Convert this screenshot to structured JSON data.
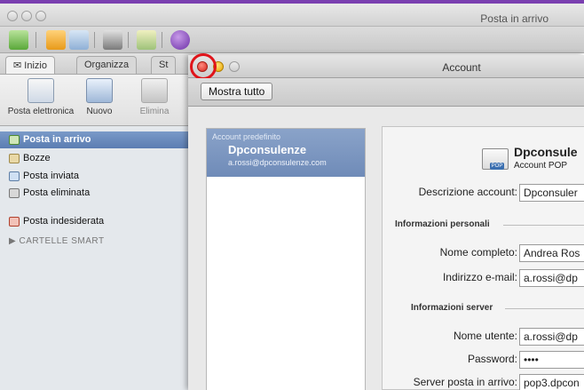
{
  "back_window": {
    "title": "Posta in arrivo",
    "ribbon_tabs": [
      "Inizio",
      "Organizza",
      "St"
    ],
    "ribbon_buttons": [
      "Posta elettronica",
      "Nuovo",
      "Elimina"
    ],
    "folders": [
      "Posta in arrivo",
      "Bozze",
      "Posta inviata",
      "Posta eliminata",
      "Posta indesiderata"
    ],
    "smart_folders": "CARTELLE SMART"
  },
  "front_window": {
    "title": "Account",
    "show_all": "Mostra tutto",
    "account_list": {
      "category": "Account predefinito",
      "name": "Dpconsulenze",
      "email": "a.rossi@dpconsulenze.com"
    },
    "detail": {
      "title": "Dpconsule",
      "subtitle": "Account POP",
      "pop_badge": "POP",
      "description_label": "Descrizione account:",
      "description_value": "Dpconsuler",
      "section_personal": "Informazioni personali",
      "fullname_label": "Nome completo:",
      "fullname_value": "Andrea Ros",
      "email_label": "Indirizzo e-mail:",
      "email_value": "a.rossi@dp",
      "section_server": "Informazioni server",
      "username_label": "Nome utente:",
      "username_value": "a.rossi@dp",
      "password_label": "Password:",
      "password_value": "••••",
      "incoming_label": "Server posta in arrivo:",
      "incoming_value": "pop3.dpcon"
    }
  },
  "colors": {
    "selection": "#6f8bb8",
    "highlight_ring": "#e0141a",
    "top_strip": "#7a3fb0"
  }
}
